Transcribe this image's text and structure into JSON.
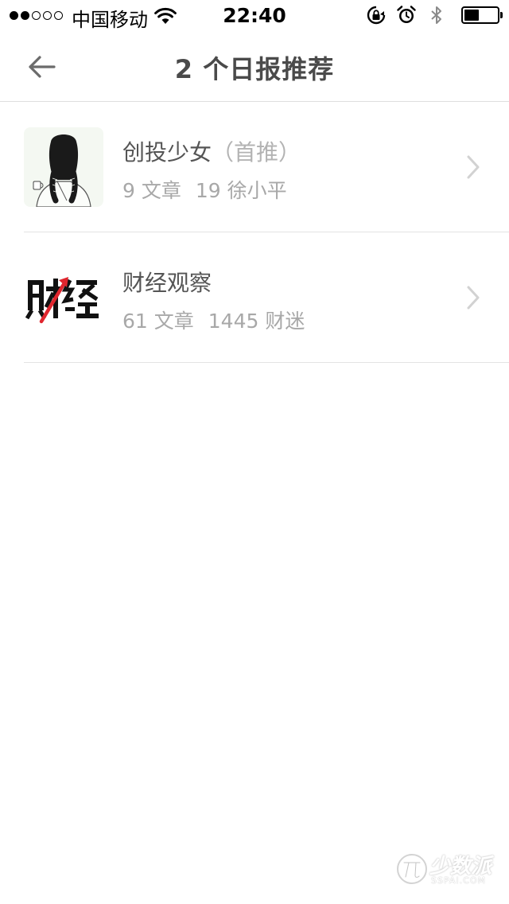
{
  "status_bar": {
    "signal_dots_filled": 2,
    "signal_dots_total": 5,
    "carrier": "中国移动",
    "time": "22:40",
    "battery_level": 0.45
  },
  "nav": {
    "title": "2 个日报推荐"
  },
  "items": [
    {
      "title": "创投少女",
      "tag": "（首推）",
      "articles": "9 文章",
      "followers": "19 徐小平",
      "thumb": "girl-illustration"
    },
    {
      "title": "财经观察",
      "tag": "",
      "articles": "61 文章",
      "followers": "1445 财迷",
      "thumb": "caijing-logo"
    }
  ],
  "watermark": {
    "text": "少数派",
    "sub": "SSPAI.COM"
  },
  "colors": {
    "title": "#4a4a4a",
    "meta": "#a8a8a8",
    "divider": "#e3e3e3",
    "logo_red": "#e0262e"
  }
}
